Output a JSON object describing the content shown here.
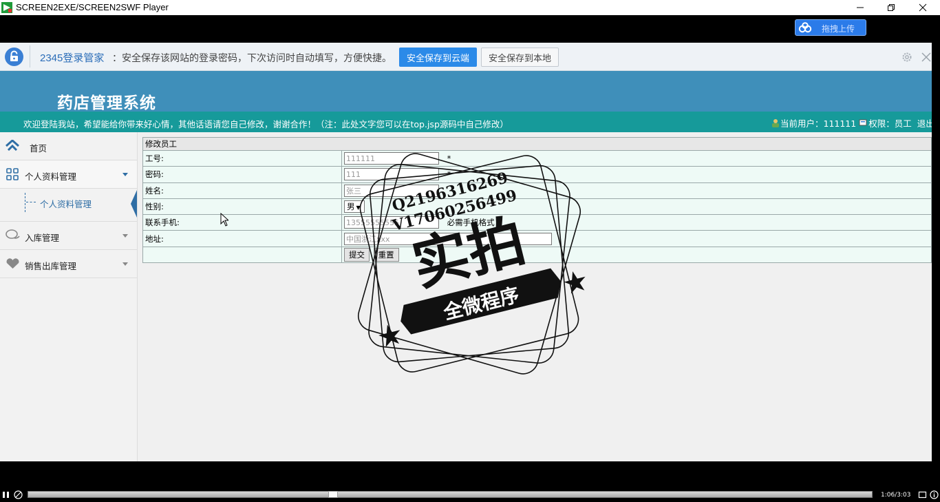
{
  "window": {
    "title": "SCREEN2EXE/SCREEN2SWF Player",
    "upload_label": "拖拽上传"
  },
  "notification": {
    "brand": "2345登录管家",
    "message": "：安全保存该网站的登录密码，下次访问时自动填写，方便快捷。",
    "btn_cloud": "安全保存到云端",
    "btn_local": "安全保存到本地"
  },
  "app": {
    "title": "药店管理系统",
    "welcome": "欢迎登陆我站，希望能给你带来好心情，其他话语请您自己修改，谢谢合作！（注：此处文字您可以在top.jsp源码中自己修改）",
    "user_label": "当前用户：111111",
    "role_label": "权限：员工",
    "logout": "退出"
  },
  "sidebar": {
    "home": "首页",
    "personal": "个人资料管理",
    "personal_sub": "个人资料管理",
    "inbound": "入库管理",
    "sales": "销售出库管理"
  },
  "form": {
    "caption": "修改员工",
    "labels": {
      "id": "工号:",
      "password": "密码:",
      "name": "姓名:",
      "gender": "性别:",
      "phone": "联系手机:",
      "address": "地址:"
    },
    "values": {
      "id": "111111",
      "password": "111",
      "name": "张三",
      "gender": "男",
      "phone": "13555555555",
      "address": "中国浙江xxx"
    },
    "required_mark": "*",
    "phone_hint": "必需手机格式",
    "submit": "提交",
    "reset": "重置"
  },
  "watermark": {
    "qq": "Q2196316269",
    "wechat": "V17060256499",
    "big": "实拍",
    "banner": "全微程序"
  },
  "player": {
    "progress": 0.36,
    "timecode": "1:06/3:03"
  },
  "colors": {
    "header": "#3f8fba",
    "welcome_bar": "#169a9a",
    "accent_blue": "#2b8ae8"
  }
}
